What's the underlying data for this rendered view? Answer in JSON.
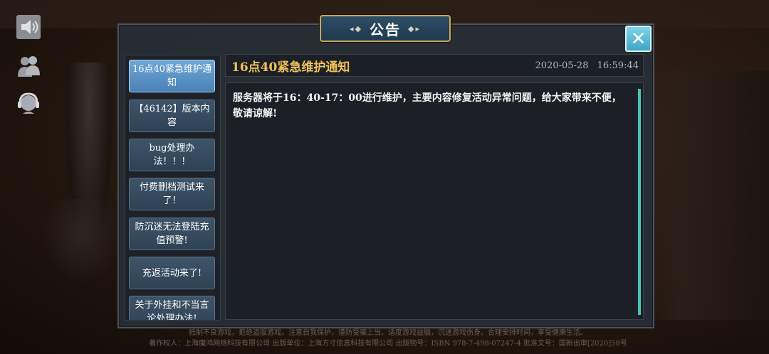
{
  "side_icons": [
    {
      "name": "speaker-icon"
    },
    {
      "name": "friends-icon"
    },
    {
      "name": "support-icon"
    }
  ],
  "dialog": {
    "title": "公告",
    "close_symbol": "✕"
  },
  "announcements": [
    {
      "label": "16点40紧急维护通知",
      "selected": true
    },
    {
      "label": "【46142】版本内容",
      "selected": false
    },
    {
      "label": "bug处理办法！！！",
      "selected": false
    },
    {
      "label": "付费删档测试来了！",
      "selected": false
    },
    {
      "label": "防沉迷无法登陆充值预警!",
      "selected": false
    },
    {
      "label": "充返活动来了!",
      "selected": false
    },
    {
      "label": "关于外挂和不当言论处理办法!",
      "selected": false
    }
  ],
  "detail": {
    "title": "16点40紧急维护通知",
    "date": "2020-05-28",
    "time": "16:59:44",
    "body": "服务器将于16：40-17：00进行维护，主要内容修复活动异常问题，给大家带来不便，敬请谅解!"
  },
  "footer": {
    "line1": "抵制不良游戏，拒绝盗版游戏。注意自我保护，谨防受骗上当。适度游戏益脑，沉迷游戏伤身。合理安排时间，享受健康生活。",
    "line2": "著作权人：上海魔鸿网络科技有限公司  出版单位：上海方寸信息科技有限公司  出版物号：ISBN 978-7-498-07247-4  批准文号：国新出审[2020]58号"
  }
}
